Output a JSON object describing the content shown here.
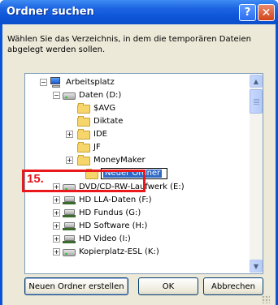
{
  "window": {
    "title": "Ordner suchen",
    "help_glyph": "?",
    "close_glyph": "✕"
  },
  "description": "Wählen Sie das Verzeichnis, in dem die temporären Dateien abgelegt werden sollen.",
  "tree": {
    "items": [
      {
        "label": "Arbeitsplatz",
        "icon": "computer-icon",
        "expander": "minus"
      },
      {
        "label": "Daten (D:)",
        "icon": "drive-icon",
        "expander": "minus"
      },
      {
        "label": "$AVG",
        "icon": "folder-icon",
        "expander": "none"
      },
      {
        "label": "Diktate",
        "icon": "folder-icon",
        "expander": "none"
      },
      {
        "label": "IDE",
        "icon": "folder-icon",
        "expander": "plus"
      },
      {
        "label": "JF",
        "icon": "folder-icon",
        "expander": "none"
      },
      {
        "label": "MoneyMaker",
        "icon": "folder-icon",
        "expander": "plus"
      },
      {
        "label": "Neuer Ordner",
        "icon": "folder-icon",
        "expander": "none"
      },
      {
        "label": "DVD/CD-RW-Laufwerk (E:)",
        "icon": "cd-drive-icon",
        "expander": "plus"
      },
      {
        "label": "HD LLA-Daten (F:)",
        "icon": "network-drive-icon",
        "expander": "plus"
      },
      {
        "label": "HD Fundus (G:)",
        "icon": "network-drive-icon",
        "expander": "plus"
      },
      {
        "label": "HD Software (H:)",
        "icon": "network-drive-icon",
        "expander": "plus"
      },
      {
        "label": "HD Video (I:)",
        "icon": "network-drive-icon",
        "expander": "plus"
      },
      {
        "label": "Kopierplatz-ESL (K:)",
        "icon": "drive-icon",
        "expander": "plus"
      }
    ],
    "edit_value": "Neuer Ordner"
  },
  "callout": {
    "number": "15."
  },
  "buttons": {
    "new_folder": "Neuen Ordner erstellen",
    "ok": "OK",
    "cancel": "Abbrechen"
  },
  "scroll": {
    "up_glyph": "▲",
    "down_glyph": "▼"
  }
}
